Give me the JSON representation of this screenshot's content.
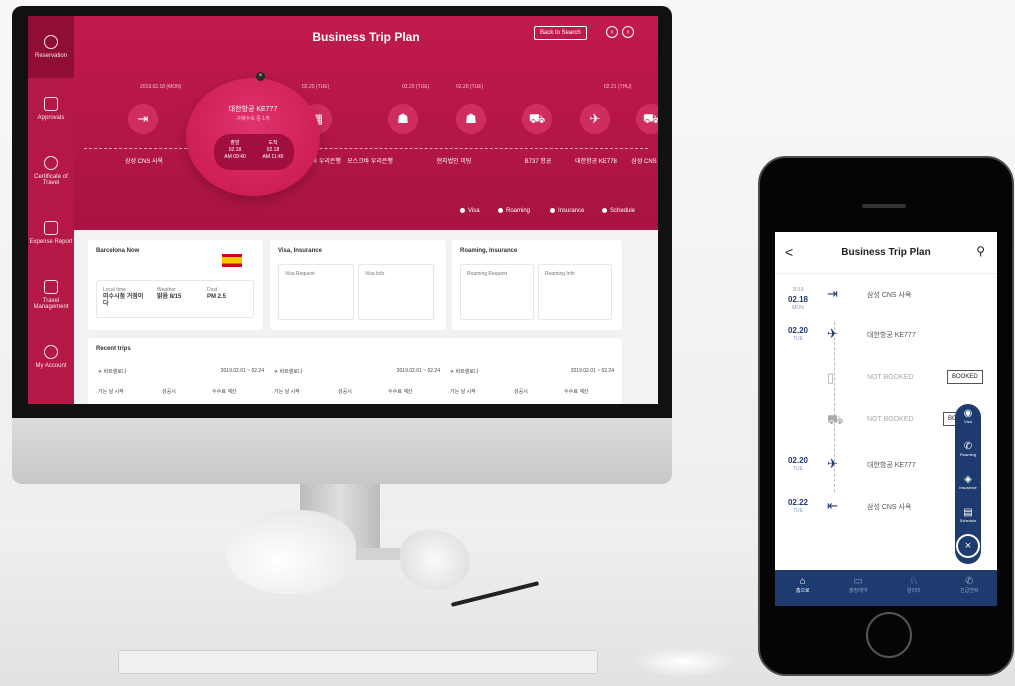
{
  "desktop": {
    "sidebar": [
      {
        "label": "Reservation"
      },
      {
        "label": "Approvals"
      },
      {
        "label": "Certificate of Travel"
      },
      {
        "label": "Expense Report"
      },
      {
        "label": "Travel Management"
      },
      {
        "label": "My Account"
      }
    ],
    "header": {
      "title": "Business Trip Plan",
      "back_label": "Back to Search",
      "prev_icon": "‹",
      "next_icon": "›"
    },
    "dates": [
      "2019.02.18 (MON)",
      "02.20 (TUE)",
      "02.20 (TUE)",
      "02.20 (TUE)",
      "02.21 (THU)"
    ],
    "timeline_labels": [
      "삼성 CNS 사옥",
      "모스크바 우리은행",
      "모스크바 우리은행",
      "현지법인 미팅",
      "B737 항공",
      "대한항공 KE778",
      "삼성 CNS"
    ],
    "popup": {
      "title": "대한항공 KE777",
      "subtitle": "구매수속 중 1개",
      "depart_label": "출발",
      "depart_date": "02.18",
      "depart_time": "AM 09:40",
      "arrive_label": "도착",
      "arrive_date": "02.18",
      "arrive_time": "AM 11:45",
      "close": "×"
    },
    "hero_footer": [
      "Visa",
      "Roaming",
      "Insurance",
      "Schedule"
    ],
    "barcelona": {
      "title": "Barcelona Now",
      "local_time_label": "Local time",
      "local_time_value": "미수시점 거점이다",
      "weather_label": "Weather",
      "weather_value": "맑음 8/15",
      "dust_label": "Dust",
      "dust_value": "PM 2.5"
    },
    "visa": {
      "title": "Visa, Insurance",
      "c1": "Visa Request",
      "c2": "Visa Info"
    },
    "roaming": {
      "title": "Roaming, Insurance",
      "c1": "Roaming Request",
      "c2": "Roaming Info"
    },
    "recent": {
      "title": "Recent trips",
      "rows": [
        {
          "dest": "✈ 바르셀로나",
          "dates": "2019.02.01 ~ 02.24",
          "l1": "가는 날 시작",
          "l2": "성공시",
          "l3": "수수료 계산"
        },
        {
          "dest": "✈ 바르셀로나",
          "dates": "2019.02.01 ~ 02.24",
          "l1": "가는 날 시작",
          "l2": "성공시",
          "l3": "수수료 계산"
        },
        {
          "dest": "✈ 바르셀로나",
          "dates": "2019.02.01 ~ 02.24",
          "l1": "가는 날 시작",
          "l2": "성공시",
          "l3": "수수료 계산"
        }
      ]
    }
  },
  "mobile": {
    "header": {
      "title": "Business Trip Plan",
      "back": "<",
      "user_icon": "⚲"
    },
    "rows": [
      {
        "year": "2019",
        "date": "02.18",
        "day": "MON",
        "text": "삼성 CNS 사옥"
      },
      {
        "year": "",
        "date": "02.20",
        "day": "TUE",
        "text": "대한항공 KE777"
      },
      {
        "year": "",
        "date": "",
        "day": "",
        "text": "NOT BOOKED",
        "badge": "BOOKED"
      },
      {
        "year": "",
        "date": "",
        "day": "",
        "text": "NOT BOOKED",
        "badge": "BOOKED"
      },
      {
        "year": "",
        "date": "02.20",
        "day": "TUE",
        "text": "대한항공 KE777"
      },
      {
        "year": "",
        "date": "02.22",
        "day": "TUE",
        "text": "삼성 CNS 사옥"
      }
    ],
    "fab": [
      "Visa",
      "Roaming",
      "Insurance",
      "Schedule"
    ],
    "fab_close": "×",
    "tabs": [
      "홈으로",
      "출장예약",
      "알리미",
      "긴급연락"
    ]
  },
  "colors": {
    "primary": "#b51746",
    "navy": "#1e3b70"
  }
}
